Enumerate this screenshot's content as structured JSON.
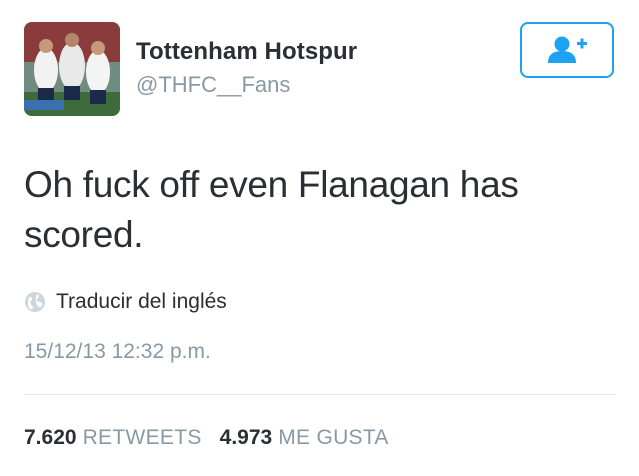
{
  "author": {
    "display_name": "Tottenham Hotspur",
    "handle": "@THFC__Fans",
    "avatar": "team-celebration-photo"
  },
  "follow_button": {
    "icon": "add-user-icon",
    "color": "#1da1f2"
  },
  "tweet": {
    "text": "Oh fuck off even Flanagan has scored.",
    "translate_icon": "globe-icon",
    "translate_label": "Traducir del inglés",
    "timestamp": "15/12/13 12:32 p.m."
  },
  "stats": {
    "retweets_count": "7.620",
    "retweets_label": "RETWEETS",
    "likes_count": "4.973",
    "likes_label": "ME GUSTA"
  },
  "colors": {
    "text_primary": "#292f33",
    "text_secondary": "#8899a6",
    "accent": "#1da1f2",
    "divider": "#e1e8ed"
  }
}
